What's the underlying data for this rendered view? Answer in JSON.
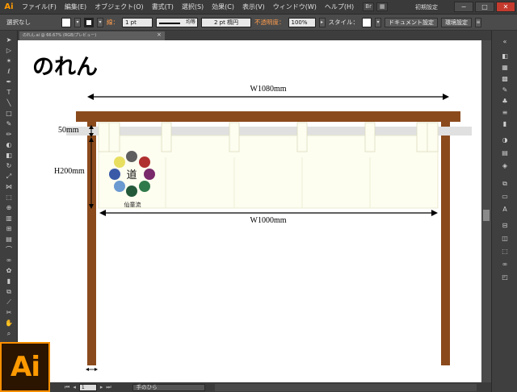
{
  "app": {
    "logo_small": "Ai",
    "logo_big": "Ai",
    "workspace": "初期設定"
  },
  "menu": [
    "ファイル(F)",
    "編集(E)",
    "オブジェクト(O)",
    "書式(T)",
    "選択(S)",
    "効果(C)",
    "表示(V)",
    "ウィンドウ(W)",
    "ヘルプ(H)"
  ],
  "window": {
    "minimize": "−",
    "maximize": "□",
    "close": "✕"
  },
  "control": {
    "selection": "選択なし",
    "stroke_label": "線：",
    "stroke_weight": "1 pt",
    "profile": "均等",
    "brush": "2 pt 楕円",
    "opacity_label": "不透明度：",
    "opacity": "100%",
    "style_label": "スタイル：",
    "doc_settings": "ドキュメント設定",
    "preferences": "環境設定"
  },
  "document": {
    "tab": "のれん.ai @ 66.67% (RGB/プレビュー)"
  },
  "drawing": {
    "title": "のれん",
    "dim_top": "W1080mm",
    "dim_rod": "50mm",
    "dim_height": "H200mm",
    "dim_bottom": "W1000mm",
    "logo_caption": "仙童流",
    "logo_kanji": "道",
    "colors": {
      "wood": "#8b4a1c",
      "rod": "#e0e0e0",
      "cloth": "#fdfdf0",
      "cloth_border": "#e8e8c8",
      "dots": [
        "#5f5f5f",
        "#b03030",
        "#7a2a6a",
        "#2f7a4a",
        "#245a3a",
        "#6a9ad0",
        "#3a5aa8",
        "#e8df60"
      ]
    }
  },
  "status": {
    "page": "1",
    "tool": "手のひら"
  }
}
